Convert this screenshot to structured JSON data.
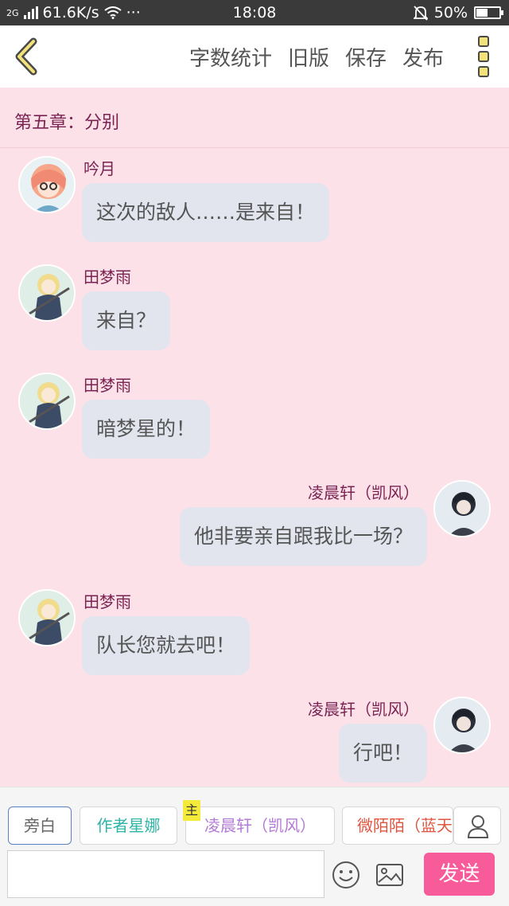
{
  "status_bar": {
    "network_type": "2G",
    "speed": "61.6K/s",
    "more": "···",
    "time": "18:08",
    "battery_percent": "50%",
    "battery_level": 0.5
  },
  "toolbar": {
    "back_icon": "chevron-left-icon",
    "word_count": "字数统计",
    "old_version": "旧版",
    "save": "保存",
    "publish": "发布",
    "menu_icon": "more-vertical-icon"
  },
  "chapter_title": "第五章：分别",
  "messages": [
    {
      "side": "left",
      "name": "吟月",
      "text": "这次的敌人……是来自！",
      "avatar": "orange-hair-girl-avatar"
    },
    {
      "side": "left",
      "name": "田梦雨",
      "text": "来自？",
      "avatar": "blonde-girl-avatar"
    },
    {
      "side": "left",
      "name": "田梦雨",
      "text": "暗梦星的！",
      "avatar": "blonde-girl-avatar"
    },
    {
      "side": "right",
      "name": "凌晨轩（凯风）",
      "text": "他非要亲自跟我比一场？",
      "avatar": "dark-hair-boy-avatar"
    },
    {
      "side": "left",
      "name": "田梦雨",
      "text": "队长您就去吧！",
      "avatar": "blonde-girl-avatar"
    },
    {
      "side": "right",
      "name": "凌晨轩（凯风）",
      "text": "行吧！",
      "avatar": "dark-hair-boy-avatar"
    }
  ],
  "roles": [
    {
      "label": "旁白",
      "color": "#666666"
    },
    {
      "label": "作者星娜",
      "color": "#2fb5a6"
    },
    {
      "label": "凌晨轩（凯风）",
      "color": "#b37ad6"
    },
    {
      "label": "微陌陌（蓝天",
      "color": "#e0553f"
    }
  ],
  "main_badge": "主",
  "input": {
    "value": "",
    "placeholder": ""
  },
  "send_label": "发送",
  "icons": {
    "emoji": "smiley-icon",
    "image": "image-icon",
    "contact": "person-icon",
    "notification": "bell-mute-icon",
    "wifi": "wifi-icon"
  },
  "colors": {
    "background": "#fce1e8",
    "name": "#7a2352",
    "bubble": "#e2e5ee",
    "send": "#f75b9a"
  }
}
